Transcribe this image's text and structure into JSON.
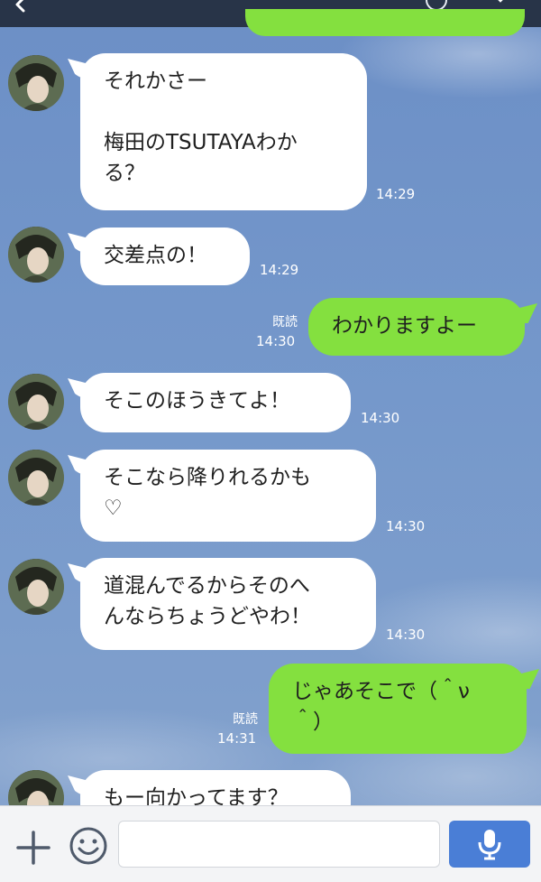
{
  "header": {
    "pages": 3,
    "active_page": 0
  },
  "messages": [
    {
      "side": "in",
      "text": "それかさー\n\n梅田のTSUTAYAわか\nる？",
      "time": "14:29"
    },
    {
      "side": "in",
      "text": "交差点の！",
      "time": "14:29"
    },
    {
      "side": "out",
      "text": "わかりますよー",
      "time": "14:30",
      "read": "既読"
    },
    {
      "side": "in",
      "text": "そこのほうきてよ！",
      "time": "14:30"
    },
    {
      "side": "in",
      "text": "そこなら降りれるかも\n♡",
      "time": "14:30"
    },
    {
      "side": "in",
      "text": "道混んでるからそのへ\nんならちょうどやわ！",
      "time": "14:30"
    },
    {
      "side": "out",
      "text": "じゃあそこで（＾ν\n＾）",
      "time": "14:31",
      "read": "既読"
    },
    {
      "side": "in",
      "text": "もー向かってます？",
      "time": ""
    }
  ],
  "input": {
    "value": "",
    "placeholder": ""
  },
  "colors": {
    "outgoing_bubble": "#84e03f",
    "incoming_bubble": "#ffffff",
    "mic_button": "#4a7ed6",
    "top_bar": "#283448"
  },
  "icons": [
    "back-chevron-icon",
    "clock-icon",
    "chevron-down-icon",
    "plus-icon",
    "smile-icon",
    "mic-icon"
  ]
}
